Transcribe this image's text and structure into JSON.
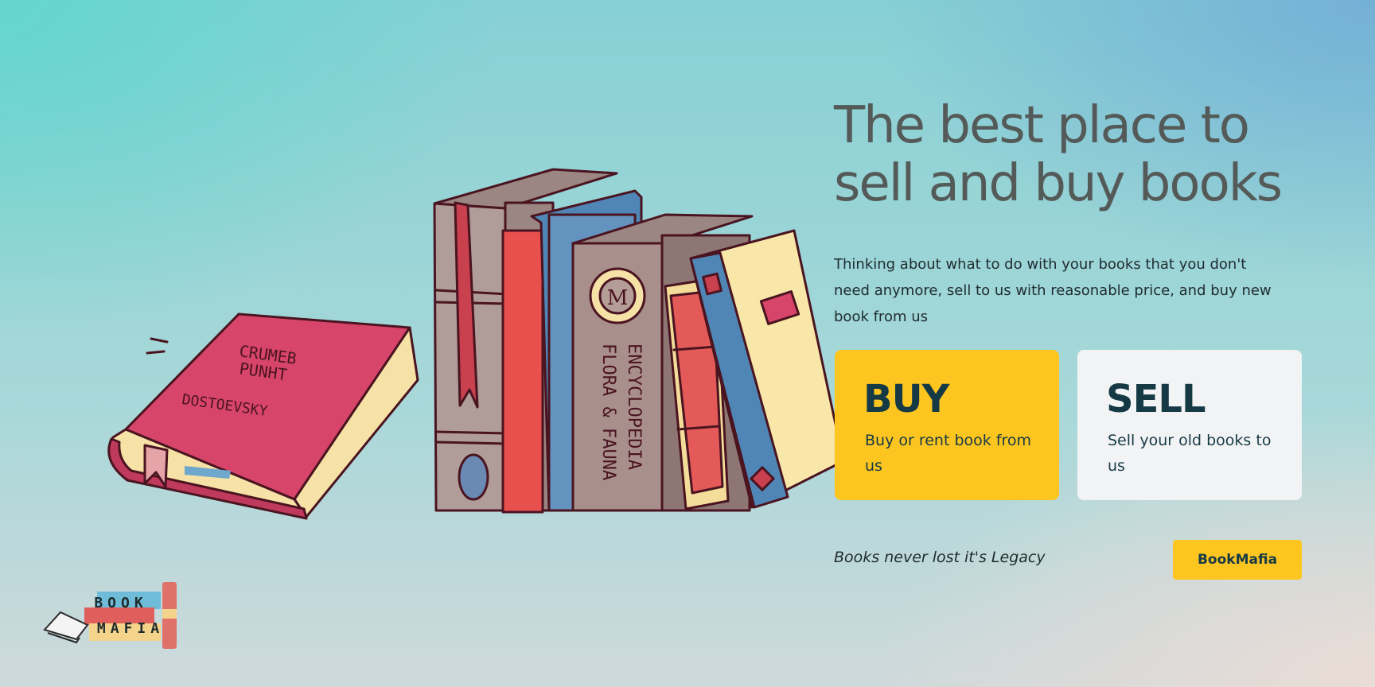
{
  "hero": {
    "headline_line1": "The best place to",
    "headline_line2": "sell and buy books",
    "description": "Thinking about what to do with your books that you don't need anymore, sell to us with reasonable price, and buy new book from us"
  },
  "cards": {
    "buy": {
      "title": "BUY",
      "text": "Buy or rent book from us"
    },
    "sell": {
      "title": "SELL",
      "text": "Sell your old books to us"
    }
  },
  "footer": {
    "tagline": "Books never lost it's Legacy",
    "brand_button_label": "BookMafia"
  },
  "illustration": {
    "red_book_cover": [
      "CRUMEB",
      "PUNHT",
      "DOSTOEVSKY"
    ],
    "encyclopedia_spine": [
      "FLORA & FAUNA",
      "ENCYCLOPEDIA"
    ],
    "encyclopedia_emblem": "M"
  },
  "logo": {
    "line1": "BOOK",
    "line2": "MAFIA"
  },
  "colors": {
    "accent_yellow": "#fcc520",
    "heading_gray": "#545a58",
    "dark_teal": "#163a45",
    "card_white": "#f2f3f5"
  }
}
